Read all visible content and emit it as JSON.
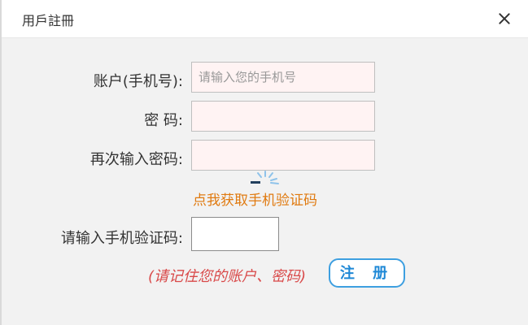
{
  "dialog": {
    "title": "用戶註冊"
  },
  "form": {
    "account_label": "账户(手机号):",
    "account_placeholder": "请输入您的手机号",
    "password_label": "密 码:",
    "confirm_label": "再次输入密码:",
    "get_code_link": "点我获取手机验证码",
    "code_label": "请输入手机验证码:",
    "note": "(请记住您的账户、密码)",
    "register_button": "注 册"
  },
  "colors": {
    "accent": "#1e88d6",
    "link": "#e07a10",
    "note": "#d94a4a",
    "input_bg": "#fff3f3"
  }
}
